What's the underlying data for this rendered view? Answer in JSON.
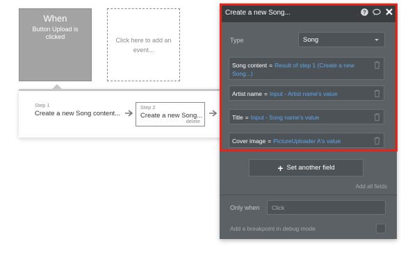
{
  "events": {
    "when_title": "When",
    "when_description": "Button Upload is clicked",
    "add_event_text": "Click here to add an event..."
  },
  "steps": [
    {
      "number": "Step 1",
      "title": "Create a new Song content..."
    },
    {
      "number": "Step 2",
      "title": "Create a new Song...",
      "delete_label": "delete"
    }
  ],
  "panel": {
    "title": "Create a new Song...",
    "header_icons": [
      "help-icon",
      "comment-icon",
      "close-icon"
    ],
    "type_label": "Type",
    "type_value": "Song",
    "fields": [
      {
        "name": "Song content",
        "operator": "=",
        "value": "Result of step 1 (Create a new Song...)"
      },
      {
        "name": "Artist name",
        "operator": "=",
        "value": "Input - Artist name's value"
      },
      {
        "name": "Title",
        "operator": "=",
        "value": "Input - Song name's value"
      },
      {
        "name": "Cover image",
        "operator": "=",
        "value": "PictureUploader A's value"
      }
    ],
    "set_another_field": "Set another field",
    "add_all_fields": "Add all fields",
    "only_when_label": "Only when",
    "only_when_placeholder": "Click",
    "breakpoint_label": "Add a breakpoint in debug mode"
  },
  "colors": {
    "highlight": "#e5251a",
    "panel_bg": "#5c6166",
    "header_bg": "#3a3d40",
    "link_value": "#5ea7ec",
    "event_when_bg": "#a3a3a3"
  }
}
